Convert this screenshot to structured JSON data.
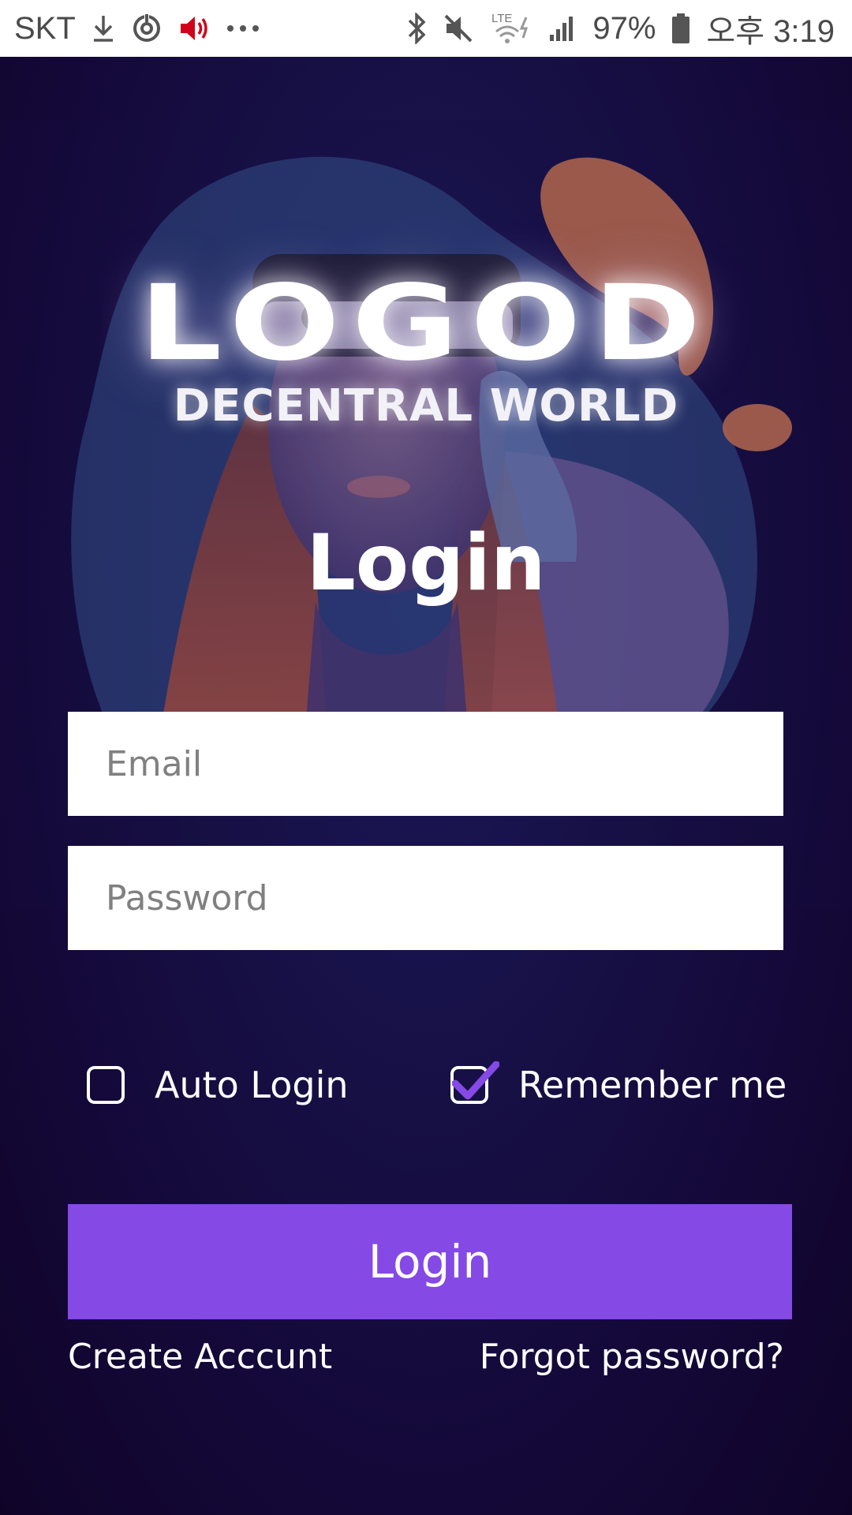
{
  "status_bar": {
    "carrier": "SKT",
    "battery": "97%",
    "time": "오후 3:19",
    "network": "LTE",
    "icons": [
      "download-icon",
      "sync-icon",
      "volume-icon",
      "more-dots-icon",
      "bluetooth-icon",
      "mute-icon",
      "lte-signal-icon",
      "cell-signal-icon",
      "battery-icon"
    ],
    "volume_icon_color": "#d0021b"
  },
  "hero": {
    "logo_main": "LOGOD",
    "logo_sub": "DECENTRAL WORLD",
    "image_description_icon": "vr-headset-woman-illustration"
  },
  "login": {
    "title": "Login",
    "email_placeholder": "Email",
    "password_placeholder": "Password",
    "auto_login_label": "Auto Login",
    "auto_login_checked": false,
    "remember_me_label": "Remember me",
    "remember_me_checked": true,
    "submit_label": "Login",
    "create_account_label": "Create Acccunt",
    "forgot_password_label": "Forgot password?"
  },
  "colors": {
    "accent": "#8549e6",
    "background": "#120631",
    "checkmark": "#8549e6"
  }
}
